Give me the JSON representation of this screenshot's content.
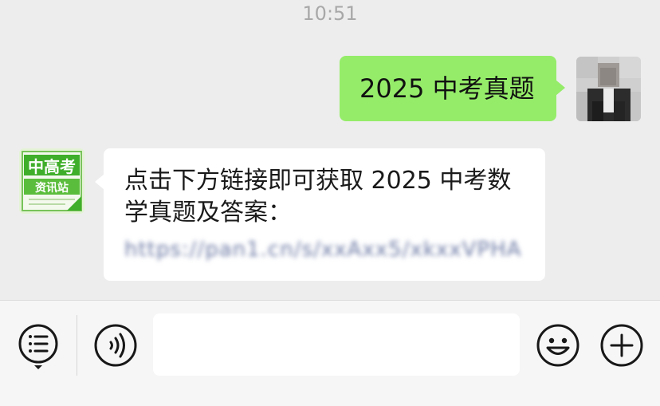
{
  "status": {
    "time": "10:51"
  },
  "chat": {
    "messages": [
      {
        "direction": "outgoing",
        "text": "2025 中考真题"
      },
      {
        "direction": "incoming",
        "sender_logo_text": [
          "中高考",
          "资讯站"
        ],
        "text": "点击下方链接即可获取 2025 中考数学真题及答案：",
        "link_text": "https://pan1.cn/s/xxAxx5/xkxxVPHA"
      }
    ]
  },
  "input_bar": {
    "icons": [
      "menu-list-icon",
      "voice-icon",
      "emoji-icon",
      "plus-icon"
    ],
    "message_input_value": ""
  },
  "colors": {
    "background": "#ededed",
    "outgoing_bubble": "#95ec69",
    "incoming_bubble": "#ffffff",
    "timestamp": "#a8a8a8",
    "brand_green": "#3fae2a",
    "icon_stroke": "#181818"
  }
}
